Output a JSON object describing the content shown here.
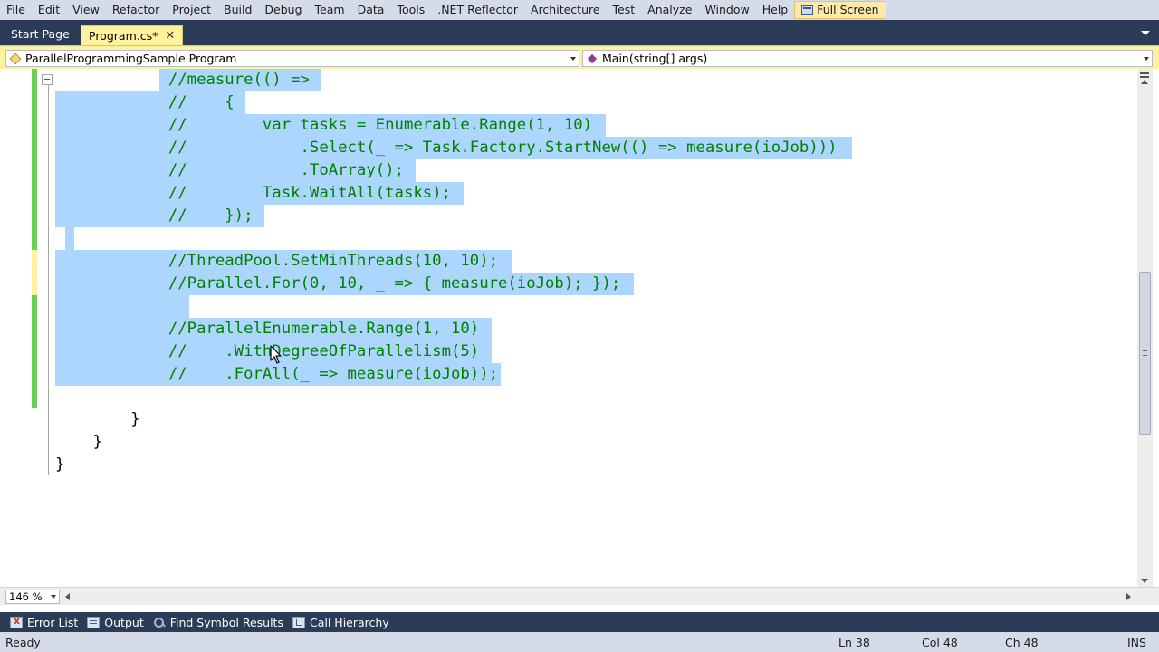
{
  "menu": [
    "File",
    "Edit",
    "View",
    "Refactor",
    "Project",
    "Build",
    "Debug",
    "Team",
    "Data",
    "Tools",
    ".NET Reflector",
    "Architecture",
    "Test",
    "Analyze",
    "Window",
    "Help"
  ],
  "fullscreen_label": "Full Screen",
  "tabs": {
    "start_page": "Start Page",
    "active_file": "Program.cs*",
    "close_glyph": "✕"
  },
  "navbar": {
    "types": "ParallelProgrammingSample.Program",
    "members": "Main(string[] args)"
  },
  "code": {
    "lines": [
      "            //measure(() =>",
      "            //    {",
      "            //        var tasks = Enumerable.Range(1, 10)",
      "            //            .Select(_ => Task.Factory.StartNew(() => measure(ioJob)))",
      "            //            .ToArray();",
      "            //        Task.WaitAll(tasks);",
      "            //    });",
      "",
      "            //ThreadPool.SetMinThreads(10, 10);",
      "            //Parallel.For(0, 10, _ => { measure(ioJob); });",
      "",
      "            //ParallelEnumerable.Range(1, 10)",
      "            //    .WithDegreeOfParallelism(5)",
      "            //    .ForAll(_ => measure(ioJob));",
      "",
      "        }",
      "    }",
      "}"
    ]
  },
  "zoom": "146 %",
  "tool_windows": [
    "Error List",
    "Output",
    "Find Symbol Results",
    "Call Hierarchy"
  ],
  "status": {
    "ready": "Ready",
    "line": "Ln 38",
    "col": "Col 48",
    "ch": "Ch 48",
    "mode": "INS"
  },
  "colors": {
    "comment": "#008000",
    "selection": "#add6ff",
    "chrome_dark": "#2b3c59",
    "chrome_light": "#d6dbe9",
    "active_tab": "#fff29d",
    "changed_saved": "#6ccf55",
    "changed_unsaved": "#fdf2a4"
  }
}
